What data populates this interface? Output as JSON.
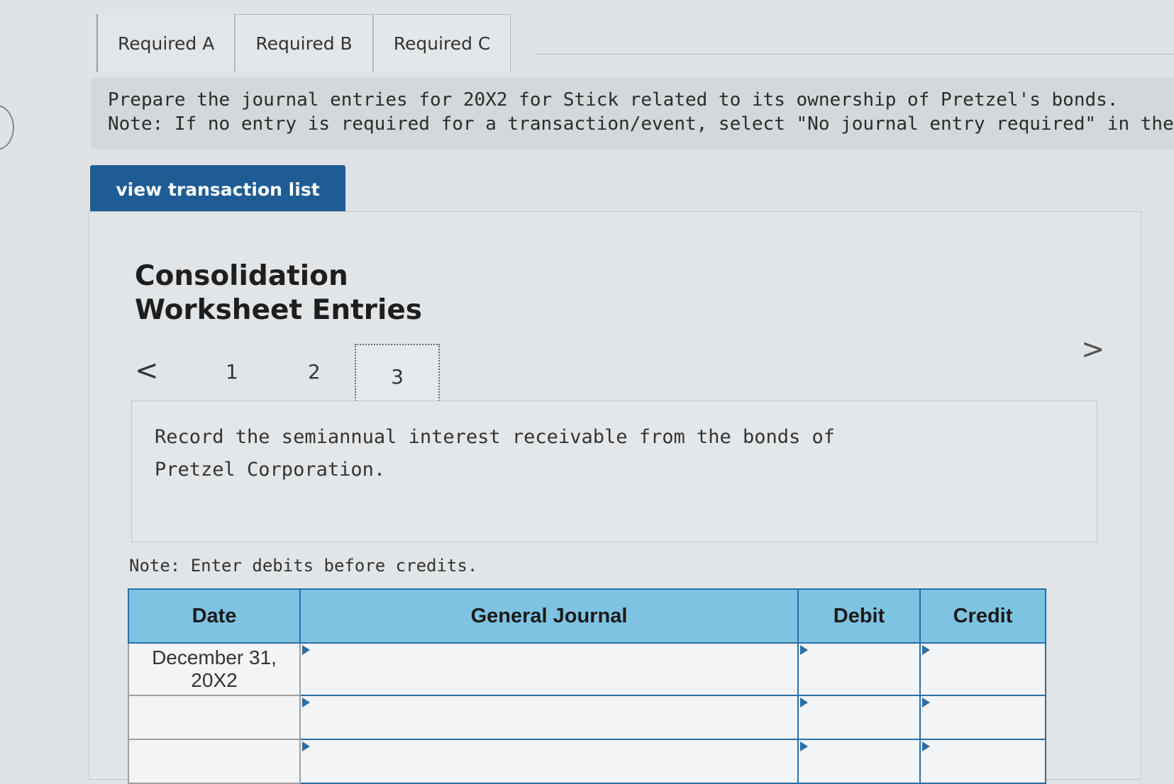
{
  "tabs": [
    {
      "label": "Required A",
      "active": true
    },
    {
      "label": "Required B",
      "active": false
    },
    {
      "label": "Required C",
      "active": false
    }
  ],
  "instructions": {
    "line1": "Prepare the journal entries for 20X2 for Stick related to its ownership of Pretzel's bonds.",
    "line2": "Note: If no entry is required for a transaction/event, select \"No journal entry required\" in the first accou"
  },
  "view_button": {
    "label": "view transaction list"
  },
  "worksheet": {
    "title_line1": "Consolidation",
    "title_line2": "Worksheet Entries"
  },
  "pager": {
    "prev": "<",
    "pages": [
      "1",
      "2",
      "3"
    ],
    "current": "3",
    "next": ">"
  },
  "description": "Record the semiannual interest receivable from the bonds of Pretzel Corporation.",
  "note": "Note: Enter debits before credits.",
  "journal": {
    "headers": {
      "date": "Date",
      "general_journal": "General Journal",
      "debit": "Debit",
      "credit": "Credit"
    },
    "rows": [
      {
        "date": "December 31, 20X2",
        "general_journal": "",
        "debit": "",
        "credit": ""
      },
      {
        "date": "",
        "general_journal": "",
        "debit": "",
        "credit": ""
      },
      {
        "date": "",
        "general_journal": "",
        "debit": "",
        "credit": ""
      }
    ]
  },
  "colors": {
    "button_bg": "#1f5c95",
    "table_header_bg": "#7ec4e2",
    "table_border": "#2a6ea7"
  }
}
